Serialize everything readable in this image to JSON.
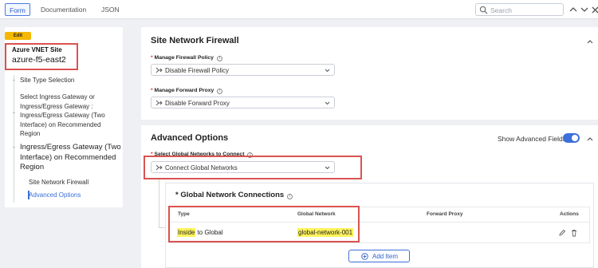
{
  "tabs": [
    {
      "label": "Form",
      "active": true
    },
    {
      "label": "Documentation",
      "active": false
    },
    {
      "label": "JSON",
      "active": false
    }
  ],
  "search": {
    "placeholder": "Search"
  },
  "sidebar": {
    "edit_badge": "Edit",
    "site_type": "Azure VNET Site",
    "site_name": "azure-f5-east2",
    "items": [
      {
        "label": "Site Type Selection"
      },
      {
        "lines": [
          "Select Ingress Gateway or",
          "Ingress/Egress Gateway :",
          "Ingress/Egress Gateway (Two",
          "Interface) on Recommended",
          "Region"
        ]
      },
      {
        "lines": [
          "Ingress/Egress Gateway (Two",
          "Interface) on Recommended",
          "Region"
        ]
      },
      {
        "label": "Site Network Firewall"
      },
      {
        "label": "Advanced Options"
      }
    ]
  },
  "firewall_section": {
    "title": "Site Network Firewall",
    "policy_label": "Manage Firewall Policy",
    "policy_value": "Disable Firewall Policy",
    "proxy_label": "Manage Forward Proxy",
    "proxy_value": "Disable Forward Proxy"
  },
  "advanced_section": {
    "title": "Advanced Options",
    "toggle_label": "Show Advanced Fields",
    "toggle_on": true,
    "global_label": "Select Global Networks to Connect",
    "global_value": "Connect Global Networks",
    "connections_title": "Global Network Connections",
    "columns": [
      "Type",
      "Global Network",
      "Forward Proxy",
      "Actions"
    ],
    "rows": [
      {
        "type_highlight": "Inside",
        "type_rest": " to Global",
        "global_network": "global-network-001",
        "forward_proxy": ""
      }
    ],
    "add_item_label": "Add Item"
  },
  "colors": {
    "accent": "#3c6fd8",
    "annotation": "#d9534f",
    "highlight": "#fff35c",
    "edit_badge": "#f5b800"
  }
}
